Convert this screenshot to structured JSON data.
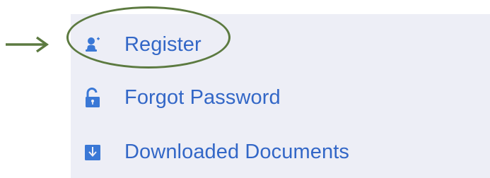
{
  "menu": {
    "items": [
      {
        "label": "Register",
        "icon": "register-user-icon"
      },
      {
        "label": "Forgot Password",
        "icon": "unlocked-padlock-icon"
      },
      {
        "label": "Downloaded Documents",
        "icon": "download-box-icon"
      }
    ]
  },
  "annotation": {
    "highlight_target": "Register",
    "color": "#5c7a40"
  },
  "colors": {
    "panel_background": "#edeef6",
    "label_text": "#3367c7",
    "icon": "#3a78d6"
  }
}
